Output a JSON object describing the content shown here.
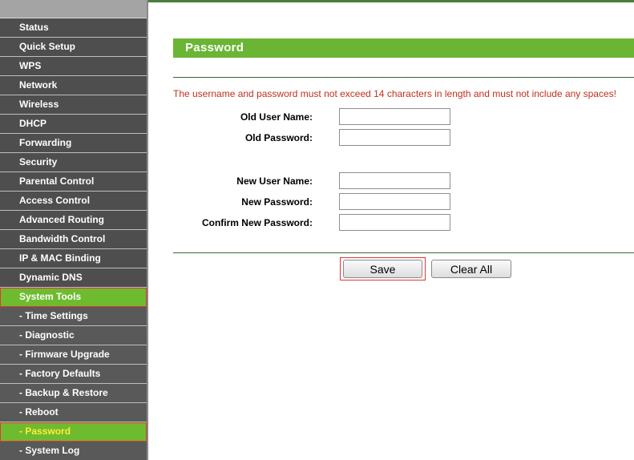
{
  "sidebar": {
    "items": [
      {
        "label": "Status"
      },
      {
        "label": "Quick Setup"
      },
      {
        "label": "WPS"
      },
      {
        "label": "Network"
      },
      {
        "label": "Wireless"
      },
      {
        "label": "DHCP"
      },
      {
        "label": "Forwarding"
      },
      {
        "label": "Security"
      },
      {
        "label": "Parental Control"
      },
      {
        "label": "Access Control"
      },
      {
        "label": "Advanced Routing"
      },
      {
        "label": "Bandwidth Control"
      },
      {
        "label": "IP & MAC Binding"
      },
      {
        "label": "Dynamic DNS"
      },
      {
        "label": "System Tools"
      },
      {
        "label": "- Time Settings"
      },
      {
        "label": "- Diagnostic"
      },
      {
        "label": "- Firmware Upgrade"
      },
      {
        "label": "- Factory Defaults"
      },
      {
        "label": "- Backup & Restore"
      },
      {
        "label": "- Reboot"
      },
      {
        "label": "- Password"
      },
      {
        "label": "- System Log"
      }
    ]
  },
  "page": {
    "title": "Password",
    "warning": "The username and password must not exceed 14 characters in length and must not include any spaces!"
  },
  "form": {
    "old_user_name_label": "Old User Name:",
    "old_password_label": "Old Password:",
    "new_user_name_label": "New User Name:",
    "new_password_label": "New Password:",
    "confirm_password_label": "Confirm New Password:",
    "old_user_name_value": "",
    "old_password_value": "",
    "new_user_name_value": "",
    "new_password_value": "",
    "confirm_password_value": ""
  },
  "buttons": {
    "save": "Save",
    "clear_all": "Clear All"
  },
  "colors": {
    "accent_green": "#6ab534",
    "warning_red": "#c0311e",
    "sidebar_dark": "#4e4e4e",
    "highlight_red": "#e0363a"
  }
}
